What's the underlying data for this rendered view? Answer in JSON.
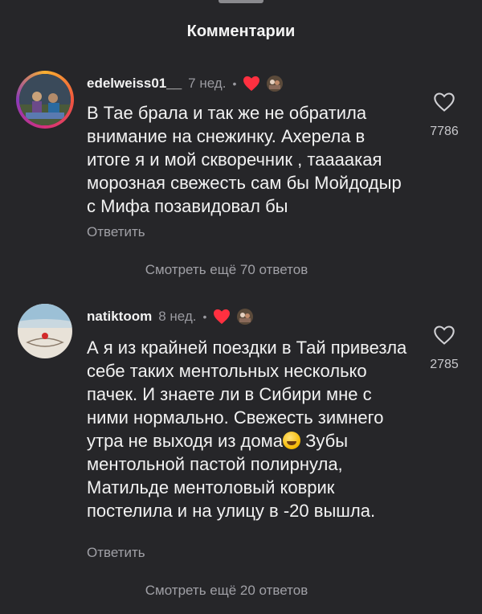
{
  "header": {
    "title": "Комментарии"
  },
  "comments": [
    {
      "username": "edelweiss01__",
      "time": "7 нед.",
      "separator": "•",
      "text": "В Тае брала и так же не обратила внимание на снежинку. Ахерела в итоге я и мой скворечник , таааакая морозная свежесть сам бы Мойдодыр с Мифа позавидовал бы",
      "likes": "7786",
      "reply_label": "Ответить",
      "more_replies": "Смотреть ещё 70 ответов"
    },
    {
      "username": "natiktoom",
      "time": "8 нед.",
      "separator": "•",
      "text_before_emoji": "А я из крайней поездки в Тай привезла себе таких ментольных несколько пачек. И знаете ли в Сибири мне с ними нормально. Свежесть зимнего утра не выходя из дома",
      "text_after_emoji": " Зубы ментольной пастой полирнула, Матильде ментоловый коврик постелила и на улицу в -20 вышла.",
      "likes": "2785",
      "reply_label": "Ответить",
      "more_replies": "Смотреть ещё 20 ответов"
    }
  ],
  "colors": {
    "background": "#262629",
    "heart": "#ff3040",
    "muted_text": "#a0a0a6"
  },
  "icons": [
    "heart-icon",
    "author-avatar-icon",
    "like-heart-outline-icon",
    "laughing-emoji-icon"
  ]
}
